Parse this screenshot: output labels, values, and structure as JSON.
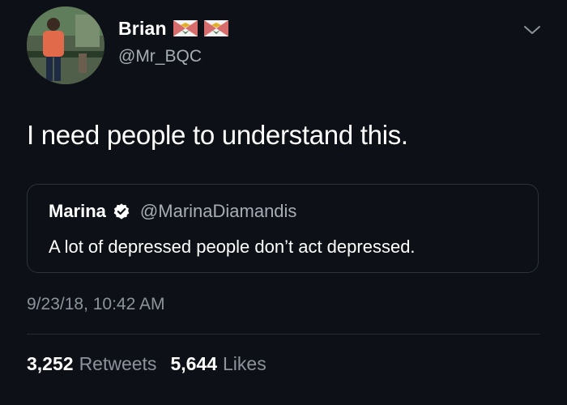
{
  "tweet": {
    "author": {
      "display_name": "Brian",
      "handle": "@Mr_BQC",
      "avatar_icon": "avatar-photo",
      "flag_icon": "flag-icon"
    },
    "text": "I need people to understand this.",
    "quoted": {
      "display_name": "Marina",
      "handle": "@MarinaDiamandis",
      "verified_icon": "verified-badge-icon",
      "text": "A lot of depressed people don’t act depressed."
    },
    "timestamp": "9/23/18, 10:42 AM",
    "stats": {
      "retweets_count": "3,252",
      "retweets_label": "Retweets",
      "likes_count": "5,644",
      "likes_label": "Likes"
    }
  },
  "colors": {
    "background": "#0d1117",
    "primary_text": "#ffffff",
    "secondary_text": "#a7adb5",
    "border": "#2c333b"
  }
}
